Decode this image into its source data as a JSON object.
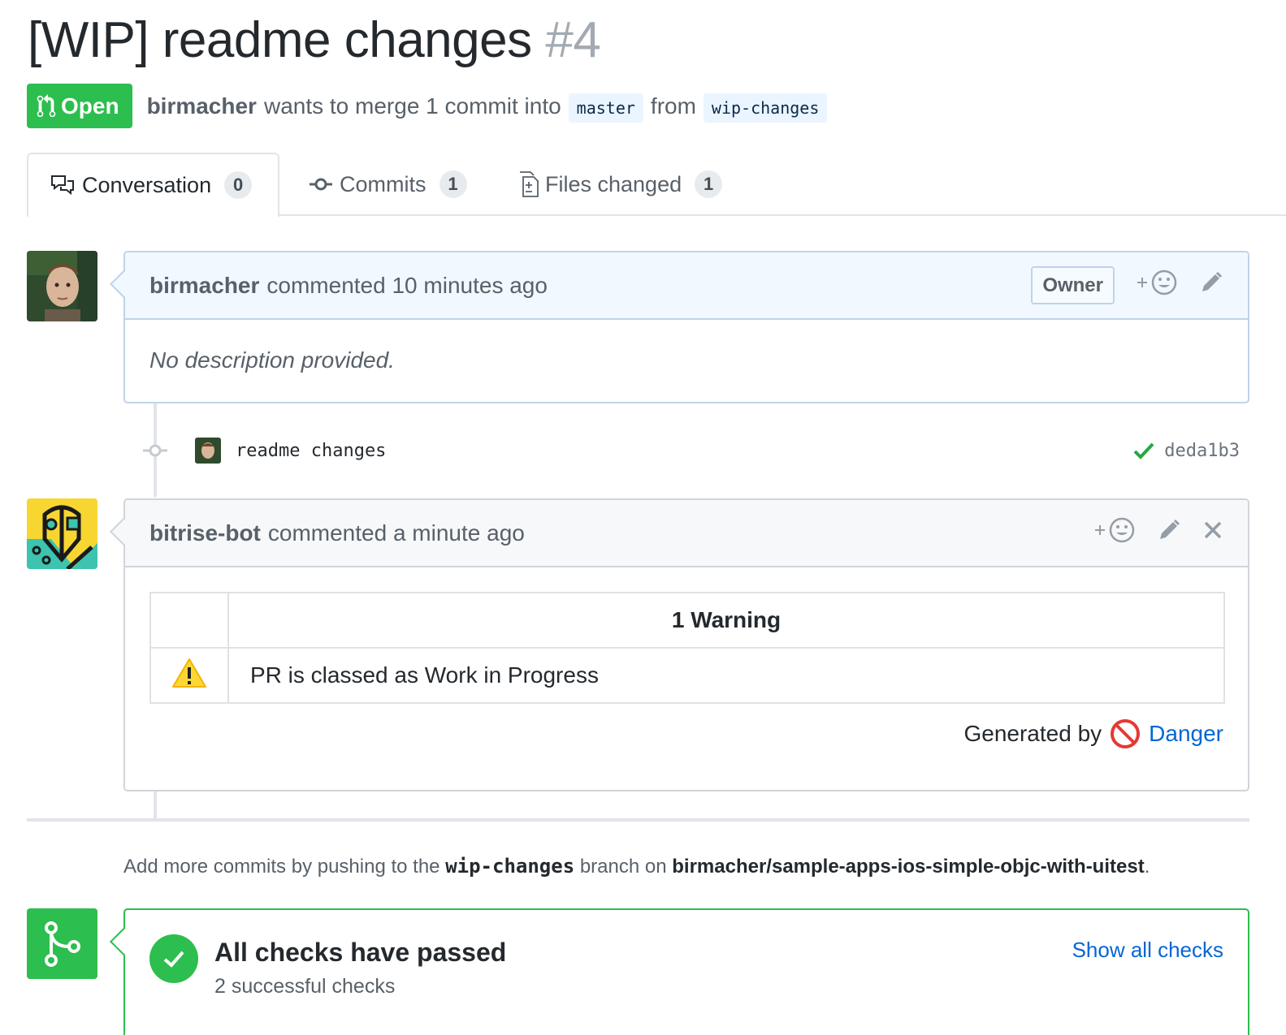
{
  "pr": {
    "title": "[WIP] readme changes",
    "number": "#4",
    "state": "Open",
    "author": "birmacher",
    "merge_text": "wants to merge 1 commit into",
    "base_branch": "master",
    "from_text": "from",
    "head_branch": "wip-changes"
  },
  "tabs": [
    {
      "label": "Conversation",
      "count": "0",
      "icon": "conversation-icon"
    },
    {
      "label": "Commits",
      "count": "1",
      "icon": "commit-icon"
    },
    {
      "label": "Files changed",
      "count": "1",
      "icon": "file-diff-icon"
    }
  ],
  "comment1": {
    "author": "birmacher",
    "timestamp": "commented 10 minutes ago",
    "badge": "Owner",
    "body": "No description provided."
  },
  "commit": {
    "message": "readme changes",
    "sha": "deda1b3"
  },
  "comment2": {
    "author": "bitrise-bot",
    "timestamp": "commented a minute ago",
    "table_header": "1 Warning",
    "warning_text": "PR is classed as Work in Progress",
    "generated_by": "Generated by",
    "danger_link": "Danger"
  },
  "hint": {
    "prefix": "Add more commits by pushing to the",
    "branch": "wip-changes",
    "middle": "branch on",
    "repo": "birmacher/sample-apps-ios-simple-objc-with-uitest",
    "suffix": "."
  },
  "checks": {
    "title": "All checks have passed",
    "subtitle": "2 successful checks",
    "link": "Show all checks"
  },
  "colors": {
    "green": "#2cbe4e",
    "link": "#0366d6",
    "owner_header_bg": "#f1f8ff"
  }
}
